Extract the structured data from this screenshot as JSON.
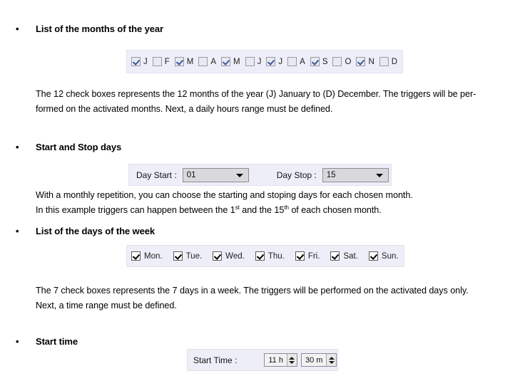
{
  "sections": {
    "months": {
      "heading": "List of the months of the year",
      "bullet": "•",
      "checkboxes": [
        {
          "label": "J",
          "checked": true
        },
        {
          "label": "F",
          "checked": false
        },
        {
          "label": "M",
          "checked": true
        },
        {
          "label": "A",
          "checked": false
        },
        {
          "label": "M",
          "checked": true
        },
        {
          "label": "J",
          "checked": false
        },
        {
          "label": "J",
          "checked": true
        },
        {
          "label": "A",
          "checked": false
        },
        {
          "label": "S",
          "checked": true
        },
        {
          "label": "O",
          "checked": false
        },
        {
          "label": "N",
          "checked": true
        },
        {
          "label": "D",
          "checked": false
        }
      ],
      "paragraph_line1": "The 12 check boxes represents the 12 months of the year (J) January to (D) December. The triggers will be per-",
      "paragraph_line2": "formed on the activated months. Next, a daily hours range must be defined."
    },
    "start_stop_days": {
      "heading": "Start and Stop days",
      "day_start_label": "Day Start :",
      "day_start_value": "01",
      "day_stop_label": "Day Stop :",
      "day_stop_value": "15",
      "paragraph_line1": "With a monthly repetition, you can choose the starting and stoping days for each chosen month.",
      "paragraph_line2_a": "In this example triggers can happen between the 1",
      "paragraph_line2_sup1": "st",
      "paragraph_line2_b": " and the 15",
      "paragraph_line2_sup2": "th",
      "paragraph_line2_c": " of each chosen month."
    },
    "week_days": {
      "heading": "List of the days of the week",
      "checkboxes": [
        {
          "label": "Mon.",
          "checked": true
        },
        {
          "label": "Tue.",
          "checked": true
        },
        {
          "label": "Wed.",
          "checked": true
        },
        {
          "label": "Thu.",
          "checked": true
        },
        {
          "label": "Fri.",
          "checked": true
        },
        {
          "label": "Sat.",
          "checked": true
        },
        {
          "label": "Sun.",
          "checked": true
        }
      ],
      "paragraph_line1": "The 7 check boxes represents the 7 days in a week. The triggers will be performed on the activated days only.",
      "paragraph_line2": "Next, a time range must be defined."
    },
    "start_time": {
      "heading": "Start time",
      "label": "Start Time :",
      "hours_value": "11 h",
      "minutes_value": "30 m"
    }
  },
  "colors": {
    "panel_bg": "#eeeef8",
    "month_check": "#3c5a9a",
    "day_check": "#000000"
  }
}
